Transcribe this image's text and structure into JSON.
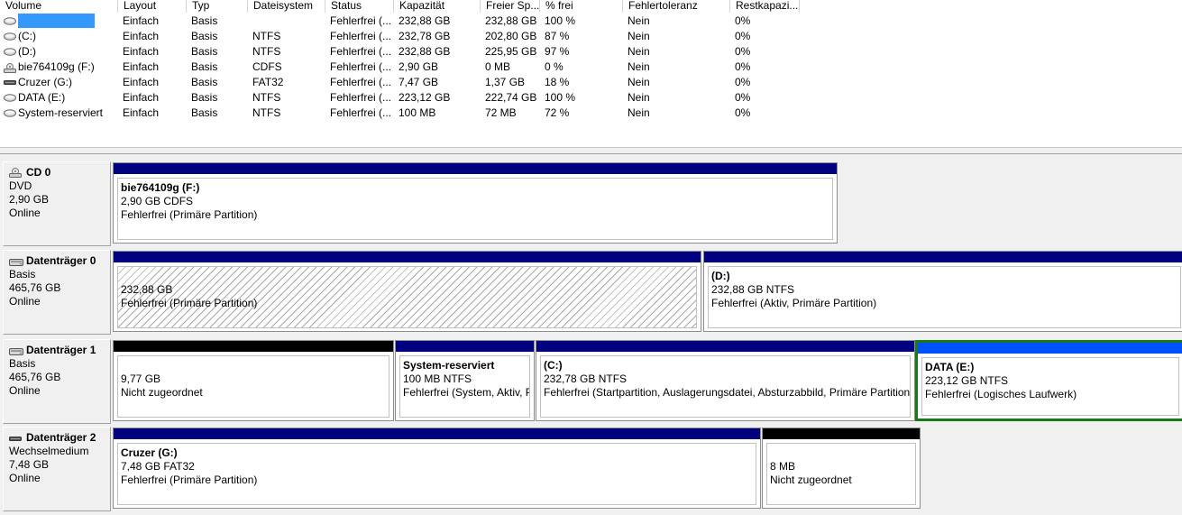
{
  "columns": [
    "Volume",
    "Layout",
    "Typ",
    "Dateisystem",
    "Status",
    "Kapazität",
    "Freier Sp...",
    "% frei",
    "Fehlertoleranz",
    "Restkapazi..."
  ],
  "volumes": [
    {
      "name": "",
      "icon": "drive-icon",
      "layout": "Einfach",
      "typ": "Basis",
      "fs": "",
      "status": "Fehlerfrei (...",
      "kap": "232,88 GB",
      "frei": "232,88 GB",
      "pct": "100 %",
      "ft": "Nein",
      "rest": "0%"
    },
    {
      "name": "(C:)",
      "icon": "drive-icon",
      "layout": "Einfach",
      "typ": "Basis",
      "fs": "NTFS",
      "status": "Fehlerfrei (...",
      "kap": "232,78 GB",
      "frei": "202,80 GB",
      "pct": "87 %",
      "ft": "Nein",
      "rest": "0%"
    },
    {
      "name": "(D:)",
      "icon": "drive-icon",
      "layout": "Einfach",
      "typ": "Basis",
      "fs": "NTFS",
      "status": "Fehlerfrei (...",
      "kap": "232,88 GB",
      "frei": "225,95 GB",
      "pct": "97 %",
      "ft": "Nein",
      "rest": "0%"
    },
    {
      "name": "bie764109g (F:)",
      "icon": "cd-drive-icon",
      "layout": "Einfach",
      "typ": "Basis",
      "fs": "CDFS",
      "status": "Fehlerfrei (...",
      "kap": "2,90 GB",
      "frei": "0 MB",
      "pct": "0 %",
      "ft": "Nein",
      "rest": "0%"
    },
    {
      "name": "Cruzer (G:)",
      "icon": "usb-drive-icon",
      "layout": "Einfach",
      "typ": "Basis",
      "fs": "FAT32",
      "status": "Fehlerfrei (...",
      "kap": "7,47 GB",
      "frei": "1,37 GB",
      "pct": "18 %",
      "ft": "Nein",
      "rest": "0%"
    },
    {
      "name": "DATA (E:)",
      "icon": "drive-icon",
      "layout": "Einfach",
      "typ": "Basis",
      "fs": "NTFS",
      "status": "Fehlerfrei (...",
      "kap": "223,12 GB",
      "frei": "222,74 GB",
      "pct": "100 %",
      "ft": "Nein",
      "rest": "0%"
    },
    {
      "name": "System-reserviert",
      "icon": "drive-icon",
      "layout": "Einfach",
      "typ": "Basis",
      "fs": "NTFS",
      "status": "Fehlerfrei (...",
      "kap": "100 MB",
      "frei": "72 MB",
      "pct": "72 %",
      "ft": "Nein",
      "rest": "0%"
    }
  ],
  "disks": [
    {
      "title": "CD 0",
      "icon": "cd-drive-icon",
      "lines": [
        "DVD",
        "2,90 GB",
        "Online"
      ],
      "partitions": [
        {
          "bar": "#000080",
          "name": "bie764109g  (F:)",
          "lines": [
            "2,90 GB CDFS",
            "Fehlerfrei (Primäre Partition)"
          ]
        }
      ]
    },
    {
      "title": "Datenträger 0",
      "icon": "disk-icon",
      "lines": [
        "Basis",
        "465,76 GB",
        "Online"
      ],
      "partitions": [
        {
          "bar": "#000080",
          "name": "",
          "lines": [
            "232,88 GB",
            "Fehlerfrei (Primäre Partition)"
          ],
          "hatched": true
        },
        {
          "bar": "#000080",
          "name": "(D:)",
          "lines": [
            "232,88 GB NTFS",
            "Fehlerfrei (Aktiv, Primäre Partition)"
          ]
        }
      ]
    },
    {
      "title": "Datenträger 1",
      "icon": "disk-icon",
      "lines": [
        "Basis",
        "465,76 GB",
        "Online"
      ],
      "partitions": [
        {
          "bar": "#000000",
          "name": "",
          "lines": [
            "9,77 GB",
            "Nicht zugeordnet"
          ]
        },
        {
          "bar": "#000080",
          "name": "System-reserviert",
          "lines": [
            "100 MB NTFS",
            "Fehlerfrei (System, Aktiv, P"
          ]
        },
        {
          "bar": "#000080",
          "name": "(C:)",
          "lines": [
            "232,78 GB NTFS",
            "Fehlerfrei (Startpartition, Auslagerungsdatei, Absturzabbild, Primäre Partition)"
          ]
        },
        {
          "bar": "#0050ff",
          "name": "DATA  (E:)",
          "lines": [
            "223,12 GB NTFS",
            "Fehlerfrei (Logisches Laufwerk)"
          ],
          "selected": true
        }
      ]
    },
    {
      "title": "Datenträger 2",
      "icon": "usb-drive-icon",
      "lines": [
        "Wechselmedium",
        "7,48 GB",
        "Online"
      ],
      "partitions": [
        {
          "bar": "#000080",
          "name": "Cruzer  (G:)",
          "lines": [
            "7,48 GB FAT32",
            "Fehlerfrei (Primäre Partition)"
          ]
        },
        {
          "bar": "#000000",
          "name": "",
          "lines": [
            "8 MB",
            "Nicht zugeordnet"
          ]
        }
      ]
    }
  ]
}
